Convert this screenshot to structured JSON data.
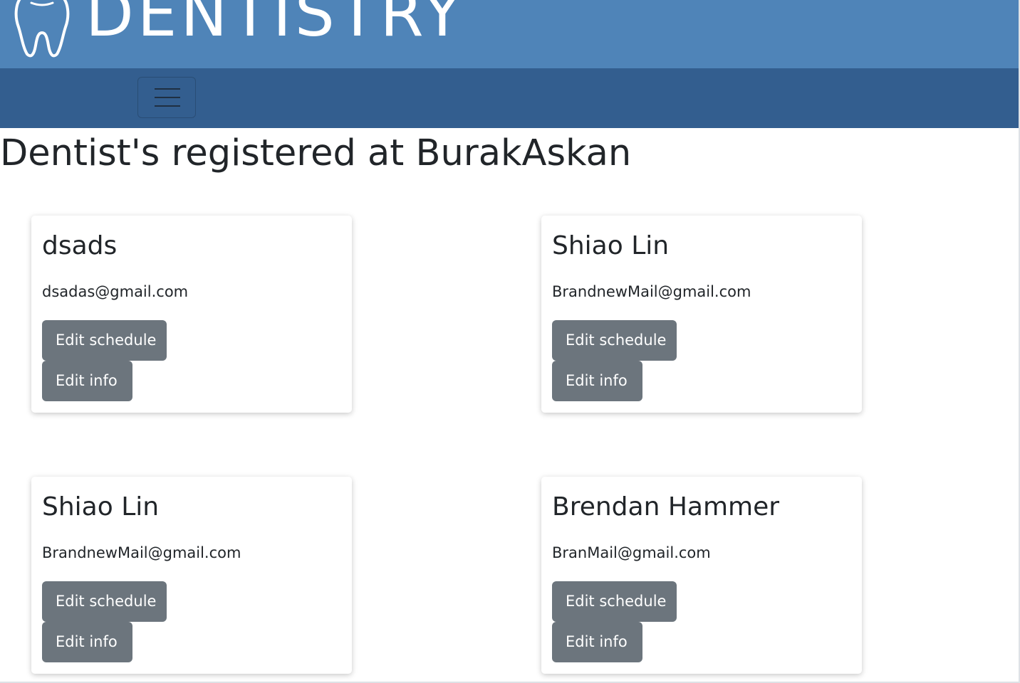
{
  "brand": {
    "name": "DENTISTRY",
    "logo_icon": "tooth-icon",
    "bar_color": "#4f84b8"
  },
  "navbar": {
    "background": "#335e8f",
    "toggler_icon": "hamburger-menu-icon"
  },
  "page": {
    "title": "Dentist's registered at BurakAskan"
  },
  "dentists": [
    {
      "name": "dsads",
      "email": "dsadas@gmail.com",
      "edit_schedule_label": "Edit schedule",
      "edit_info_label": "Edit info"
    },
    {
      "name": "Shiao Lin",
      "email": "BrandnewMail@gmail.com",
      "edit_schedule_label": "Edit schedule",
      "edit_info_label": "Edit info"
    },
    {
      "name": "Shiao Lin",
      "email": "BrandnewMail@gmail.com",
      "edit_schedule_label": "Edit schedule",
      "edit_info_label": "Edit info"
    },
    {
      "name": "Brendan Hammer",
      "email": "BranMail@gmail.com",
      "edit_schedule_label": "Edit schedule",
      "edit_info_label": "Edit info"
    }
  ],
  "colors": {
    "button": "#6c757d",
    "text": "#212529"
  }
}
